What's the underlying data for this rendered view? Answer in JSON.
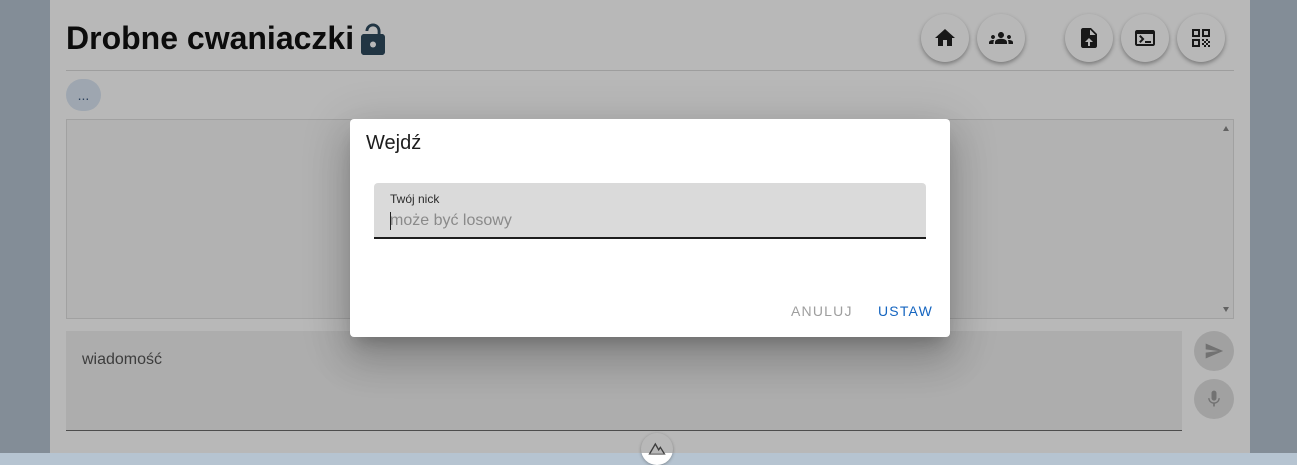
{
  "header": {
    "title": "Drobne cwaniaczki",
    "lock_icon": "lock-open-icon",
    "buttons": [
      {
        "name": "home-button",
        "icon": "home-icon"
      },
      {
        "name": "users-button",
        "icon": "group-icon"
      },
      {
        "name": "upload-file-button",
        "icon": "file-upload-icon"
      },
      {
        "name": "terminal-button",
        "icon": "terminal-icon"
      },
      {
        "name": "qr-code-button",
        "icon": "qr-code-icon"
      }
    ]
  },
  "chip": {
    "label": "..."
  },
  "message": {
    "placeholder": "wiadomość"
  },
  "side_buttons": {
    "send_icon": "send-icon",
    "mic_icon": "mic-icon"
  },
  "dialog": {
    "title": "Wejdź",
    "field_label": "Twój nick",
    "field_placeholder": "może być losowy",
    "cancel_label": "Anuluj",
    "set_label": "Ustaw"
  },
  "colors": {
    "accent": "#1565c0",
    "icon": "#2e4a5e"
  }
}
